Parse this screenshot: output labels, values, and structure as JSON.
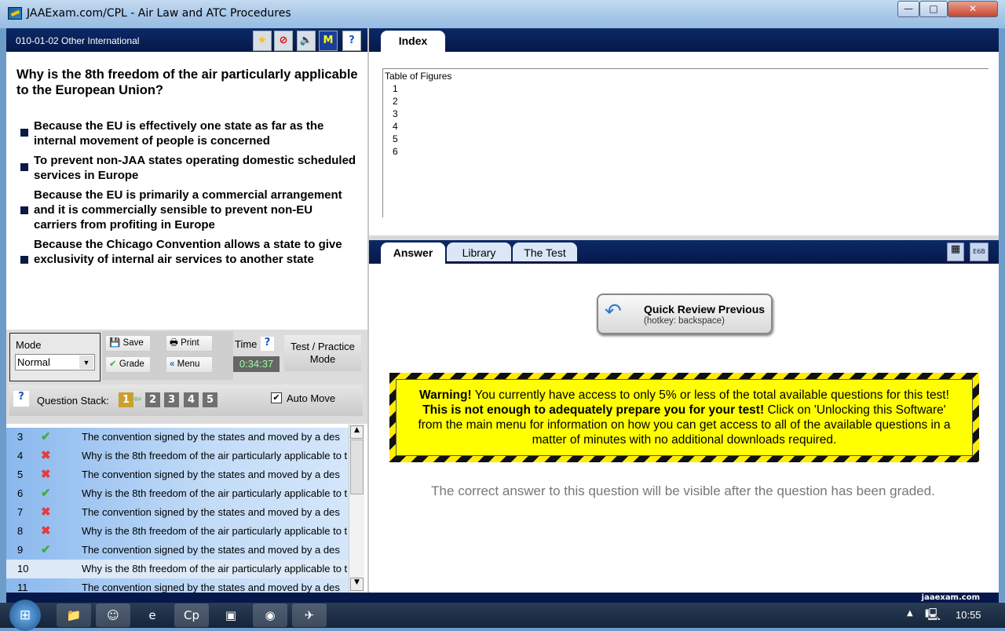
{
  "window": {
    "title": "JAAExam.com/CPL - Air Law and ATC Procedures",
    "min": "—",
    "max": "□",
    "close": "✕"
  },
  "left_header": {
    "topic": "010-01-02 Other International",
    "icons": [
      "star-icon",
      "block-icon",
      "speaker-icon",
      "memo-plus-icon",
      "help-icon"
    ],
    "help": "?"
  },
  "question": {
    "text": "Why is the 8th freedom of the air particularly applicable to the European Union?",
    "options": [
      "Because the EU is effectively one state as far as the internal movement of people is concerned",
      "To prevent non-JAA states operating domestic scheduled services in Europe",
      "Because the EU is primarily a commercial arrangement and it is commercially sensible to prevent non-EU carriers from profiting in Europe",
      "Because the Chicago Convention allows a state to give exclusivity of internal air services to another state"
    ]
  },
  "controls": {
    "mode_label": "Mode",
    "mode_value": "Normal",
    "save": "Save",
    "print": "Print",
    "grade": "Grade",
    "menu": "Menu",
    "time_label": "Time",
    "time_help": "?",
    "time_value": "0:34:37",
    "test_practice": "Test / Practice Mode",
    "stack_help": "?",
    "stack_label": "Question Stack:",
    "stack": [
      "1",
      "2",
      "3",
      "4",
      "5"
    ],
    "auto_move": "Auto Move",
    "auto_move_checked": true
  },
  "question_list": [
    {
      "n": "3",
      "status": "correct",
      "text": "The convention signed by the states and moved by a des"
    },
    {
      "n": "4",
      "status": "wrong",
      "text": "Why is the 8th freedom of the air particularly applicable to t"
    },
    {
      "n": "5",
      "status": "wrong",
      "text": "The convention signed by the states and moved by a des"
    },
    {
      "n": "6",
      "status": "correct",
      "text": "Why is the 8th freedom of the air particularly applicable to t"
    },
    {
      "n": "7",
      "status": "wrong",
      "text": "The convention signed by the states and moved by a des"
    },
    {
      "n": "8",
      "status": "wrong",
      "text": "Why is the 8th freedom of the air particularly applicable to t"
    },
    {
      "n": "9",
      "status": "correct",
      "text": "The convention signed by the states and moved by a des"
    },
    {
      "n": "10",
      "status": "current",
      "text": "Why is the 8th freedom of the air particularly applicable to t"
    },
    {
      "n": "11",
      "status": "none",
      "text": "The convention signed by the states and moved by a des"
    }
  ],
  "index": {
    "tab": "Index",
    "heading": "Table of Figures",
    "items": [
      "1",
      "2",
      "3",
      "4",
      "5",
      "6"
    ]
  },
  "answer_tabs": [
    "Answer",
    "Library",
    "The Test"
  ],
  "answer_tools": {
    "calc": "calculator-icon",
    "e6b": "E6B"
  },
  "quick_review": {
    "title": "Quick Review Previous",
    "hotkey": "(hotkey: backspace)"
  },
  "warning": {
    "w1": "Warning!",
    "t1": " You currently have access to only 5% or less of the total available questions for this test! ",
    "w2": "This is not enough to adequately prepare you for your test!",
    "t2": " Click on 'Unlocking this Software' from the main menu for information on how you can get access to all of the available questions in a matter of minutes with no additional downloads required."
  },
  "note": "The correct answer to this question will be visible after the question has been graded.",
  "status_bar": {
    "site": "jaaexam.com"
  },
  "taskbar": {
    "clock": "10:55",
    "apps": [
      "explorer",
      "yahoo-messenger",
      "internet-explorer",
      "captivate",
      "photo-viewer",
      "firefox",
      "jaaexam"
    ]
  },
  "colors": {
    "navy": "#06184a",
    "warning_yellow": "#ffff00",
    "correct": "#3cae3c",
    "wrong": "#e83a3a"
  }
}
